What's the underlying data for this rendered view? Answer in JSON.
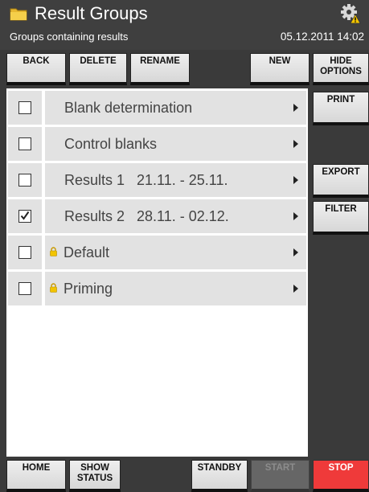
{
  "header": {
    "title": "Result Groups",
    "subtitle": "Groups containing results",
    "datetime": "05.12.2011 14:02",
    "icons": {
      "folder": "folder-icon",
      "settings": "gear-warning-icon"
    }
  },
  "toolbar": {
    "back": "BACK",
    "delete": "DELETE",
    "rename": "RENAME",
    "new": "NEW",
    "hide_options_1": "HIDE",
    "hide_options_2": "OPTIONS"
  },
  "side": {
    "print": "PRINT",
    "export": "EXPORT",
    "filter": "FILTER"
  },
  "rows": [
    {
      "label": "Blank determination",
      "checked": false,
      "locked": false
    },
    {
      "label": "Control blanks",
      "checked": false,
      "locked": false
    },
    {
      "label": "Results 1   21.11. - 25.11.",
      "checked": false,
      "locked": false
    },
    {
      "label": "Results 2   28.11. - 02.12.",
      "checked": true,
      "locked": false
    },
    {
      "label": "Default",
      "checked": false,
      "locked": true
    },
    {
      "label": "Priming",
      "checked": false,
      "locked": true
    }
  ],
  "footer": {
    "home": "HOME",
    "show_status_1": "SHOW",
    "show_status_2": "STATUS",
    "standby": "STANDBY",
    "start": "START",
    "stop": "STOP"
  },
  "colors": {
    "stop": "#ef3a3a",
    "background": "#3a3a3a",
    "row": "#e2e2e2"
  }
}
